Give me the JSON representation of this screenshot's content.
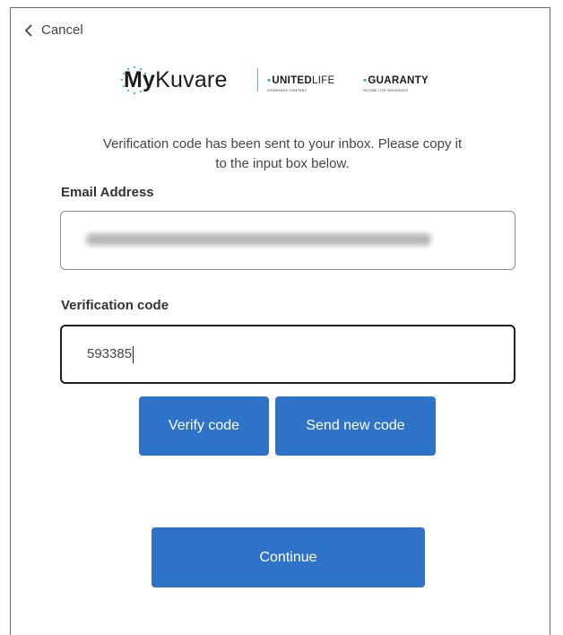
{
  "nav": {
    "cancel_label": "Cancel"
  },
  "logo": {
    "brand_my": "My",
    "brand_kuvare": "Kuvare",
    "united": "UNITED",
    "life": "LIFE",
    "united_sub": "INSURANCE COMPANY",
    "guaranty": "GUARANTY",
    "guaranty_sub": "INCOME LIFE INSURANCE"
  },
  "intro": {
    "line1": "Verification code has been sent to your inbox. Please copy it",
    "line2": "to the input box below."
  },
  "form": {
    "email_label": "Email Address",
    "email_value": "",
    "code_label": "Verification code",
    "code_value": "593385"
  },
  "buttons": {
    "verify": "Verify code",
    "send_new": "Send new code",
    "continue": "Continue"
  },
  "colors": {
    "primary": "#2f73c9",
    "brand_teal": "#2fb6a6"
  }
}
